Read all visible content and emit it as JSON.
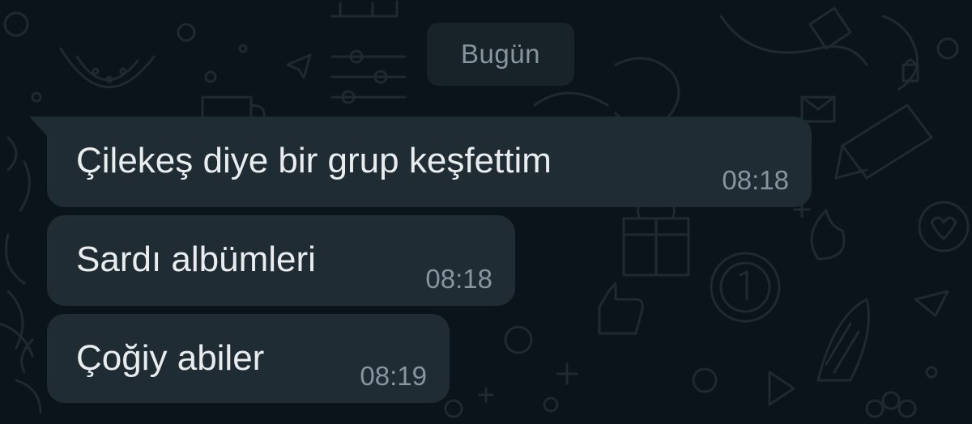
{
  "date_divider": {
    "label": "Bugün"
  },
  "messages": [
    {
      "text": "Çilekeş diye bir grup keşfettim",
      "time": "08:18"
    },
    {
      "text": "Sardı albümleri",
      "time": "08:18"
    },
    {
      "text": "Çoğiy abiler",
      "time": "08:19"
    }
  ],
  "colors": {
    "background": "#0b141a",
    "bubble_incoming": "#202c33",
    "date_chip": "#182229",
    "text_primary": "#e9edef",
    "text_secondary": "#8696a0"
  }
}
